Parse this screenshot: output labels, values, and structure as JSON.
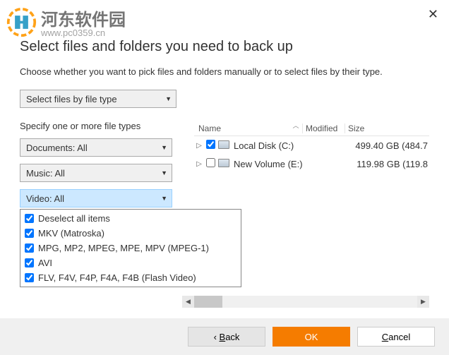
{
  "watermark": {
    "cn": "河东软件园",
    "url": "www.pc0359.cn"
  },
  "title": "Select files and folders you need to back up",
  "subtitle": "Choose whether you want to pick files and folders manually or to select files by their type.",
  "mode_combo": "Select files by file type",
  "specify_label": "Specify one or more file types",
  "type_combos": {
    "documents": "Documents: All",
    "music": "Music: All",
    "video": "Video: All"
  },
  "video_options": [
    "Deselect all items",
    "MKV (Matroska)",
    "MPG, MP2, MPEG, MPE, MPV (MPEG-1)",
    "AVI",
    "FLV, F4V, F4P, F4A, F4B (Flash Video)"
  ],
  "tree": {
    "headers": {
      "name": "Name",
      "modified": "Modified",
      "size": "Size"
    },
    "rows": [
      {
        "name": "Local Disk (C:)",
        "checked": true,
        "size": "499.40 GB (484.7"
      },
      {
        "name": "New Volume (E:)",
        "checked": false,
        "size": "119.98 GB (119.8"
      }
    ]
  },
  "buttons": {
    "back": "Back",
    "ok": "OK",
    "cancel": "Cancel"
  }
}
